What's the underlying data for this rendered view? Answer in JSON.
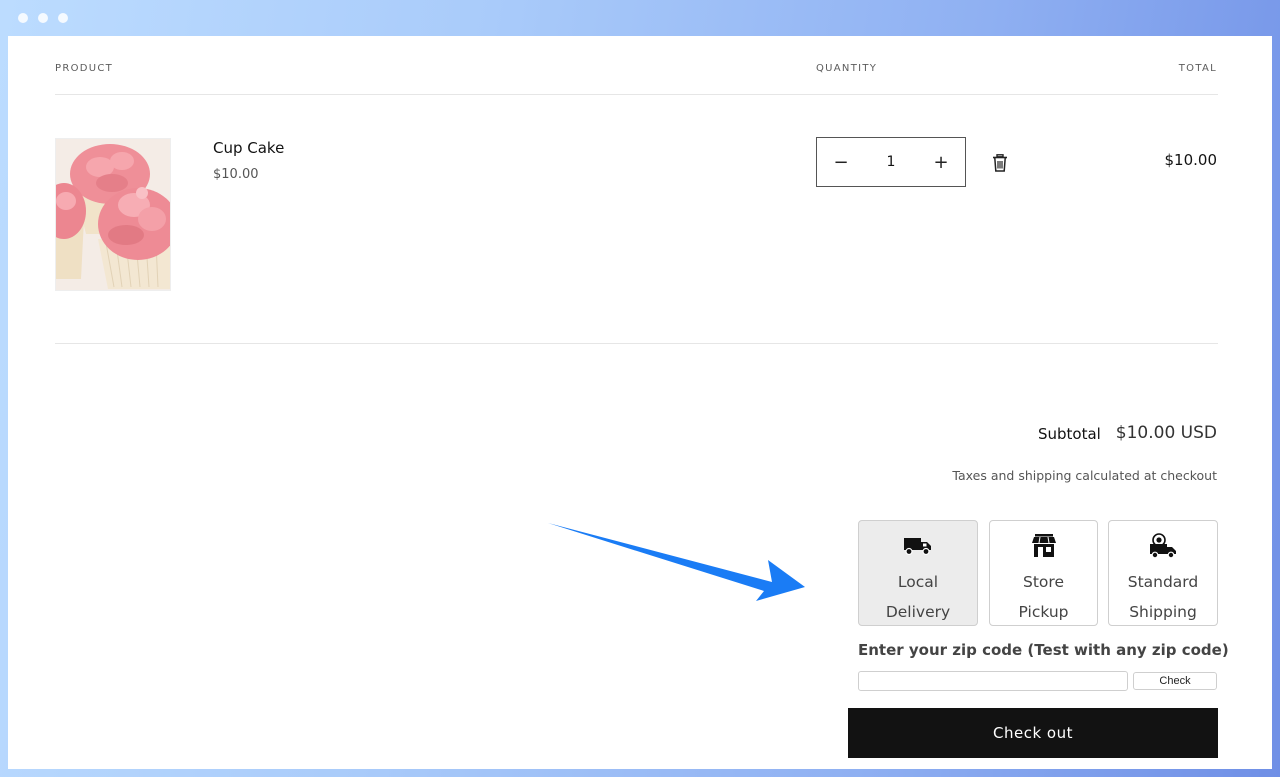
{
  "columns": {
    "product": "PRODUCT",
    "quantity": "QUANTITY",
    "total": "TOTAL"
  },
  "item": {
    "name": "Cup Cake",
    "price": "$10.00",
    "quantity": "1",
    "line_total": "$10.00",
    "image": "cupcake-photo"
  },
  "qty_controls": {
    "minus": "−",
    "plus": "+"
  },
  "summary": {
    "subtotal_label": "Subtotal",
    "subtotal_value": "$10.00 USD",
    "tax_note": "Taxes and shipping calculated at checkout"
  },
  "shipping_options": [
    {
      "label_line1": "Local",
      "label_line2": "Delivery",
      "icon": "truck-icon",
      "selected": true
    },
    {
      "label_line1": "Store",
      "label_line2": "Pickup",
      "icon": "store-icon",
      "selected": false
    },
    {
      "label_line1": "Standard",
      "label_line2": "Shipping",
      "icon": "shipping-truck-icon",
      "selected": false
    }
  ],
  "zip": {
    "label": "Enter your zip code (Test with any zip code)",
    "value": "",
    "check_label": "Check"
  },
  "checkout_label": "Check out",
  "colors": {
    "accent_arrow": "#1a7cf5",
    "button_bg": "#121212",
    "selected_option_bg": "#ececec"
  }
}
